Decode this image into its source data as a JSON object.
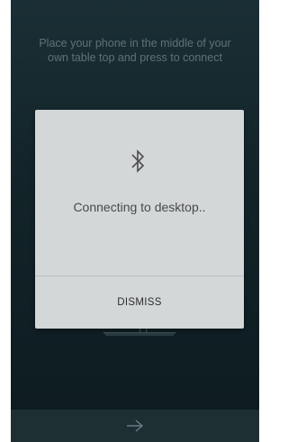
{
  "screen": {
    "instruction": "Place your phone in the middle of your own table top and press to connect",
    "next_icon": "arrow-right-icon"
  },
  "dialog": {
    "icon": "bluetooth-icon",
    "message": "Connecting to desktop..",
    "dismiss_label": "DISMISS"
  },
  "colors": {
    "background": "#122328",
    "dialog_background": "#d3d7d7",
    "instruction_text": "#5d7377",
    "bottom_bar": "#1e2f34"
  }
}
